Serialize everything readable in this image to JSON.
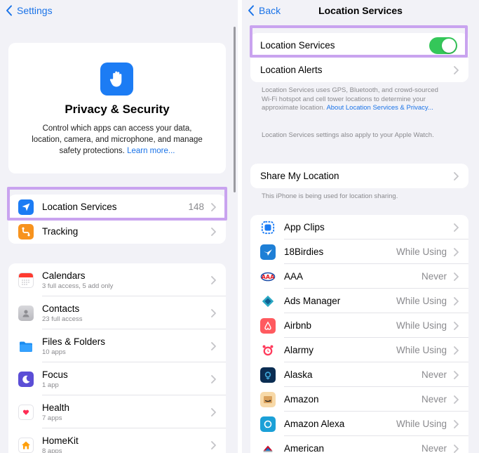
{
  "left": {
    "back_label": "Settings",
    "header": {
      "title": "Privacy & Security",
      "description": "Control which apps can access your data, location, camera, and microphone, and manage safety protections.",
      "learn_more": "Learn more..."
    },
    "location": {
      "label": "Location Services",
      "value": "148"
    },
    "tracking": {
      "label": "Tracking"
    },
    "items": [
      {
        "label": "Calendars",
        "subtitle": "3 full access, 5 add only"
      },
      {
        "label": "Contacts",
        "subtitle": "23 full access"
      },
      {
        "label": "Files & Folders",
        "subtitle": "10 apps"
      },
      {
        "label": "Focus",
        "subtitle": "1 app"
      },
      {
        "label": "Health",
        "subtitle": "7 apps"
      },
      {
        "label": "HomeKit",
        "subtitle": "8 apps"
      }
    ]
  },
  "right": {
    "back_label": "Back",
    "title": "Location Services",
    "toggle_label": "Location Services",
    "alerts_label": "Location Alerts",
    "note1": "Location Services uses GPS, Bluetooth, and crowd-sourced Wi-Fi hotspot and cell tower locations to determine your approximate location.",
    "note1_link": "About Location Services & Privacy...",
    "note2": "Location Services settings also apply to your Apple Watch.",
    "share_label": "Share My Location",
    "share_note": "This iPhone is being used for location sharing.",
    "apps": [
      {
        "name": "App Clips",
        "status": ""
      },
      {
        "name": "18Birdies",
        "status": "While Using"
      },
      {
        "name": "AAA",
        "status": "Never"
      },
      {
        "name": "Ads Manager",
        "status": "While Using"
      },
      {
        "name": "Airbnb",
        "status": "While Using"
      },
      {
        "name": "Alarmy",
        "status": "While Using"
      },
      {
        "name": "Alaska",
        "status": "Never"
      },
      {
        "name": "Amazon",
        "status": "Never"
      },
      {
        "name": "Amazon Alexa",
        "status": "While Using"
      },
      {
        "name": "American",
        "status": "Never"
      }
    ]
  },
  "colors": {
    "accent": "#1a73e8",
    "highlight": "#c9a3ef",
    "toggle_on": "#34c759",
    "background": "#f2f2f7"
  },
  "icons": {
    "location": "location-arrow-icon",
    "tracking": "tracking-icon",
    "privacy": "raised-hand-icon"
  }
}
